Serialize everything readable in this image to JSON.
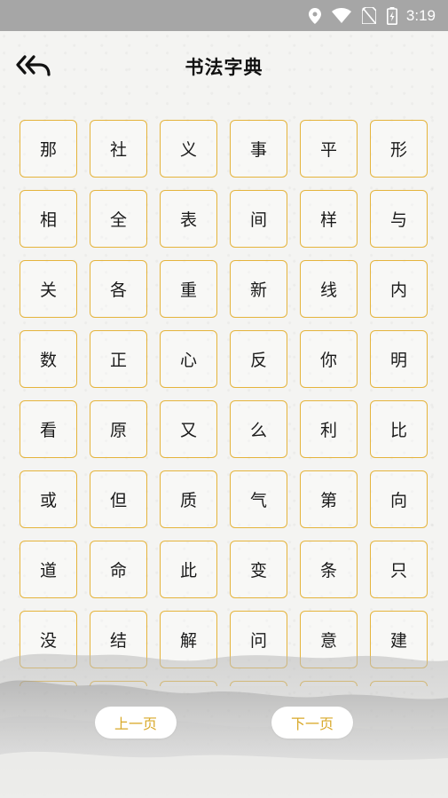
{
  "status_bar": {
    "time": "3:19",
    "icons": [
      "location-icon",
      "wifi-icon",
      "no-sim-icon",
      "battery-charging-icon"
    ]
  },
  "header": {
    "title": "书法字典",
    "back_icon": "double-back-arrow-icon"
  },
  "characters": [
    "那",
    "社",
    "义",
    "事",
    "平",
    "形",
    "相",
    "全",
    "表",
    "间",
    "样",
    "与",
    "关",
    "各",
    "重",
    "新",
    "线",
    "内",
    "数",
    "正",
    "心",
    "反",
    "你",
    "明",
    "看",
    "原",
    "又",
    "么",
    "利",
    "比",
    "或",
    "但",
    "质",
    "气",
    "第",
    "向",
    "道",
    "命",
    "此",
    "变",
    "条",
    "只",
    "没",
    "结",
    "解",
    "问",
    "意",
    "建"
  ],
  "pagination": {
    "prev_label": "上一页",
    "next_label": "下一页"
  },
  "colors": {
    "accent": "#e5b43c",
    "button_text": "#d9a92a",
    "status_bar": "#a6a6a6",
    "background": "#f4f4f2"
  }
}
